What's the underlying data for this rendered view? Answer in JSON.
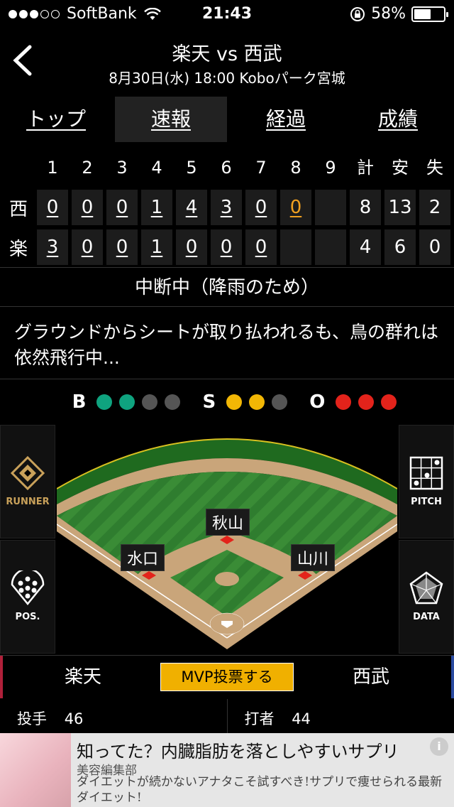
{
  "status": {
    "carrier": "SoftBank",
    "time": "21:43",
    "battery": "58%",
    "signal_filled": 3,
    "signal_total": 5,
    "battery_level": 0.58
  },
  "header": {
    "title": "楽天 vs 西武",
    "subtitle": "8月30日(水) 18:00 Koboパーク宮城"
  },
  "tabs": [
    "トップ",
    "速報",
    "経過",
    "成績"
  ],
  "scoreboard": {
    "innings": [
      "1",
      "2",
      "3",
      "4",
      "5",
      "6",
      "7",
      "8",
      "9"
    ],
    "totals_headers": [
      "計",
      "安",
      "失"
    ],
    "rows": [
      {
        "team": "西",
        "scores": [
          "0",
          "0",
          "0",
          "1",
          "4",
          "3",
          "0",
          "0",
          ""
        ],
        "totals": [
          "8",
          "13",
          "2"
        ]
      },
      {
        "team": "楽",
        "scores": [
          "3",
          "0",
          "0",
          "1",
          "0",
          "0",
          "0",
          "",
          ""
        ],
        "totals": [
          "4",
          "6",
          "0"
        ]
      }
    ]
  },
  "game_status": "中断中（降雨のため）",
  "comment": "グラウンドからシートが取り払われるも、鳥の群れは依然飛行中...",
  "count": {
    "b_label": "B",
    "s_label": "S",
    "o_label": "O",
    "balls": 2,
    "strikes": 2,
    "outs": 3,
    "colors": {
      "ball": "#0fa37f",
      "strike": "#f2b705",
      "out": "#e3231b",
      "off": "#555555"
    }
  },
  "side_buttons": {
    "runner": "RUNNER",
    "pitch": "PITCH",
    "pos": "POS.",
    "data": "DATA"
  },
  "fielders": {
    "cf": "秋山",
    "lf": "水口",
    "rf": "山川"
  },
  "mvp": {
    "home": "楽天",
    "button": "MVP投票する",
    "away": "西武"
  },
  "players": {
    "pitcher_label": "投手",
    "pitcher_no": "46",
    "batter_label": "打者",
    "batter_no": "44"
  },
  "ad": {
    "headline": "知ってた？内臓脂肪を落としやすいサプリ",
    "publisher": "美容編集部",
    "description": "ダイエットが続かないアナタこそ試すべき!サプリで痩せられる最新ダイエット!"
  }
}
